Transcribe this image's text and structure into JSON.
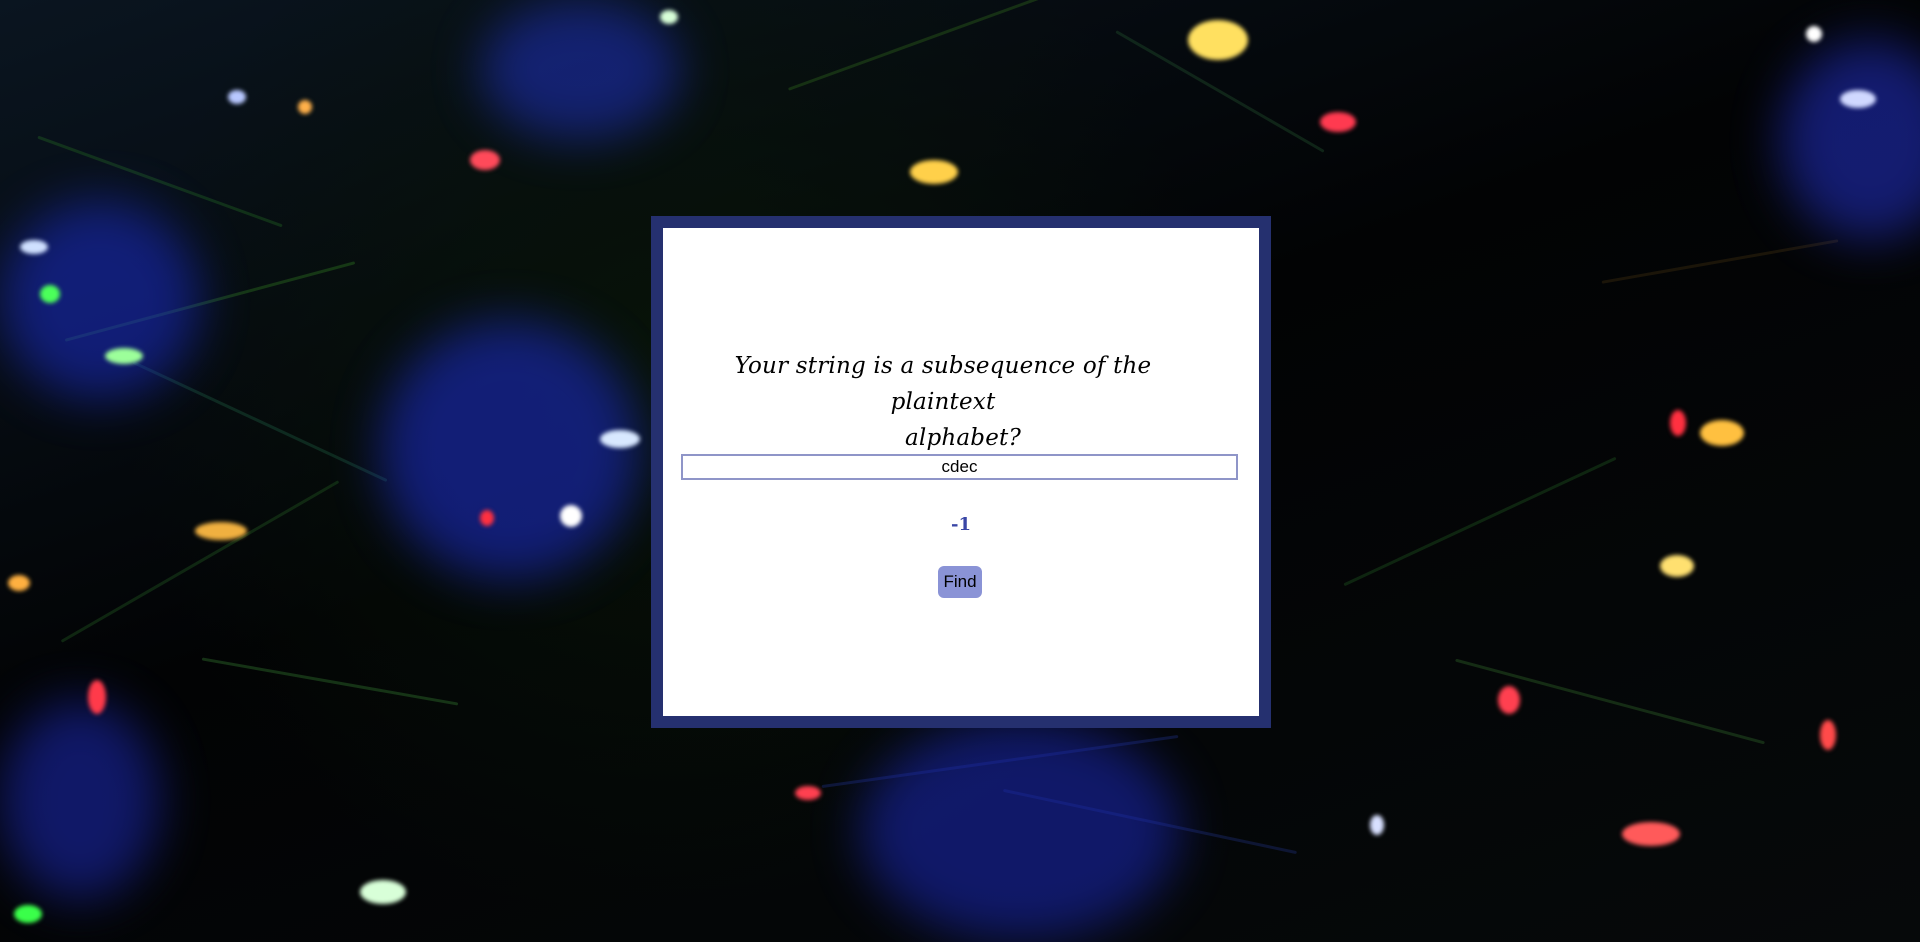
{
  "prompt": {
    "line1": "Your string is a subsequence of the plaintext",
    "line2": "alphabet?"
  },
  "input": {
    "value": "cdec"
  },
  "result": {
    "text": "-1"
  },
  "find_button": {
    "label": "Find"
  },
  "colors": {
    "frame": "#25306f",
    "input_border": "#8f95c8",
    "result_text": "#3a46a6",
    "button_bg": "#8a93d6"
  },
  "background": {
    "icon": "christmas-tree-lights-photo"
  }
}
